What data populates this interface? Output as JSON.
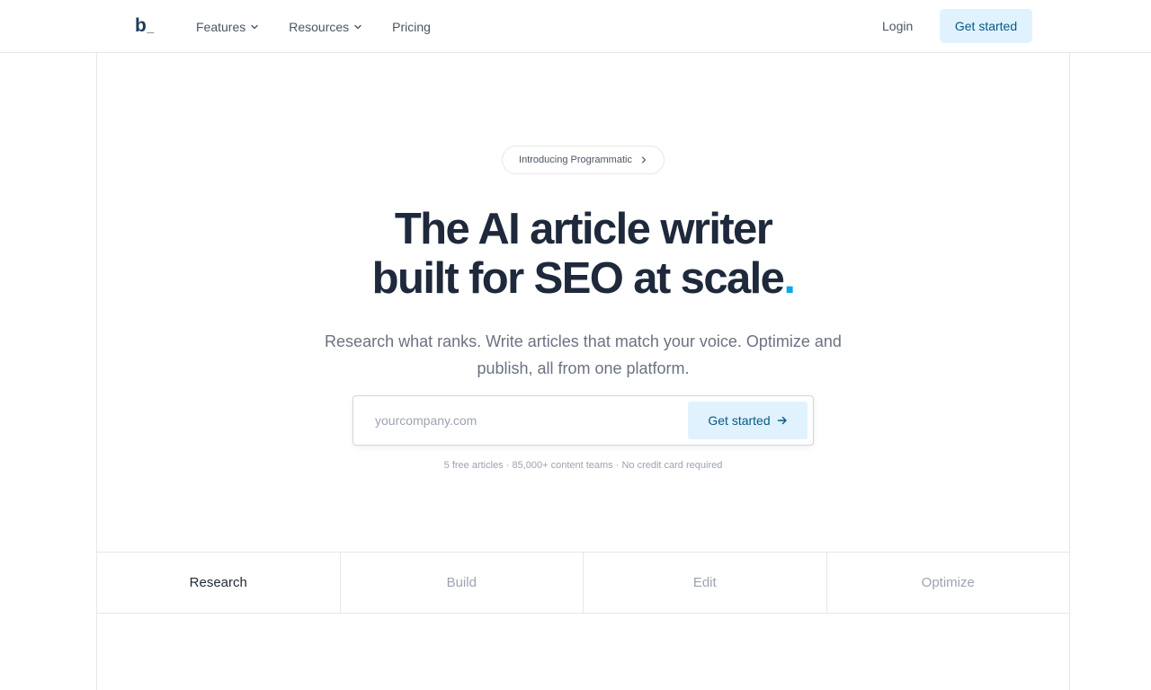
{
  "header": {
    "logo": {
      "letter": "b",
      "cursor": "_"
    },
    "nav": [
      {
        "label": "Features",
        "has_dropdown": true,
        "icon": "chevron-down-icon"
      },
      {
        "label": "Resources",
        "has_dropdown": true,
        "icon": "chevron-down-icon"
      },
      {
        "label": "Pricing",
        "has_dropdown": false
      }
    ],
    "login_label": "Login",
    "cta_label": "Get started"
  },
  "hero": {
    "announcement": {
      "label": "Introducing Programmatic",
      "icon": "chevron-right-icon"
    },
    "headline_line1": "The AI article writer",
    "headline_line2": "built for SEO at scale",
    "headline_dot": ".",
    "subheadline": "Research what ranks. Write articles that match your voice. Optimize and publish, all from one platform.",
    "form": {
      "placeholder": "yourcompany.com",
      "value": "",
      "button_label": "Get started",
      "button_icon": "arrow-right-icon"
    },
    "trust_line": "5 free articles · 85,000+ content teams · No credit card required"
  },
  "tabs": [
    {
      "label": "Research",
      "active": true
    },
    {
      "label": "Build",
      "active": false
    },
    {
      "label": "Edit",
      "active": false
    },
    {
      "label": "Optimize",
      "active": false
    }
  ],
  "colors": {
    "accent": "#0ea5e9",
    "cta_bg": "#e0f2fe",
    "cta_text": "#075985",
    "heading": "#1e293b",
    "border": "#e5e7eb"
  }
}
